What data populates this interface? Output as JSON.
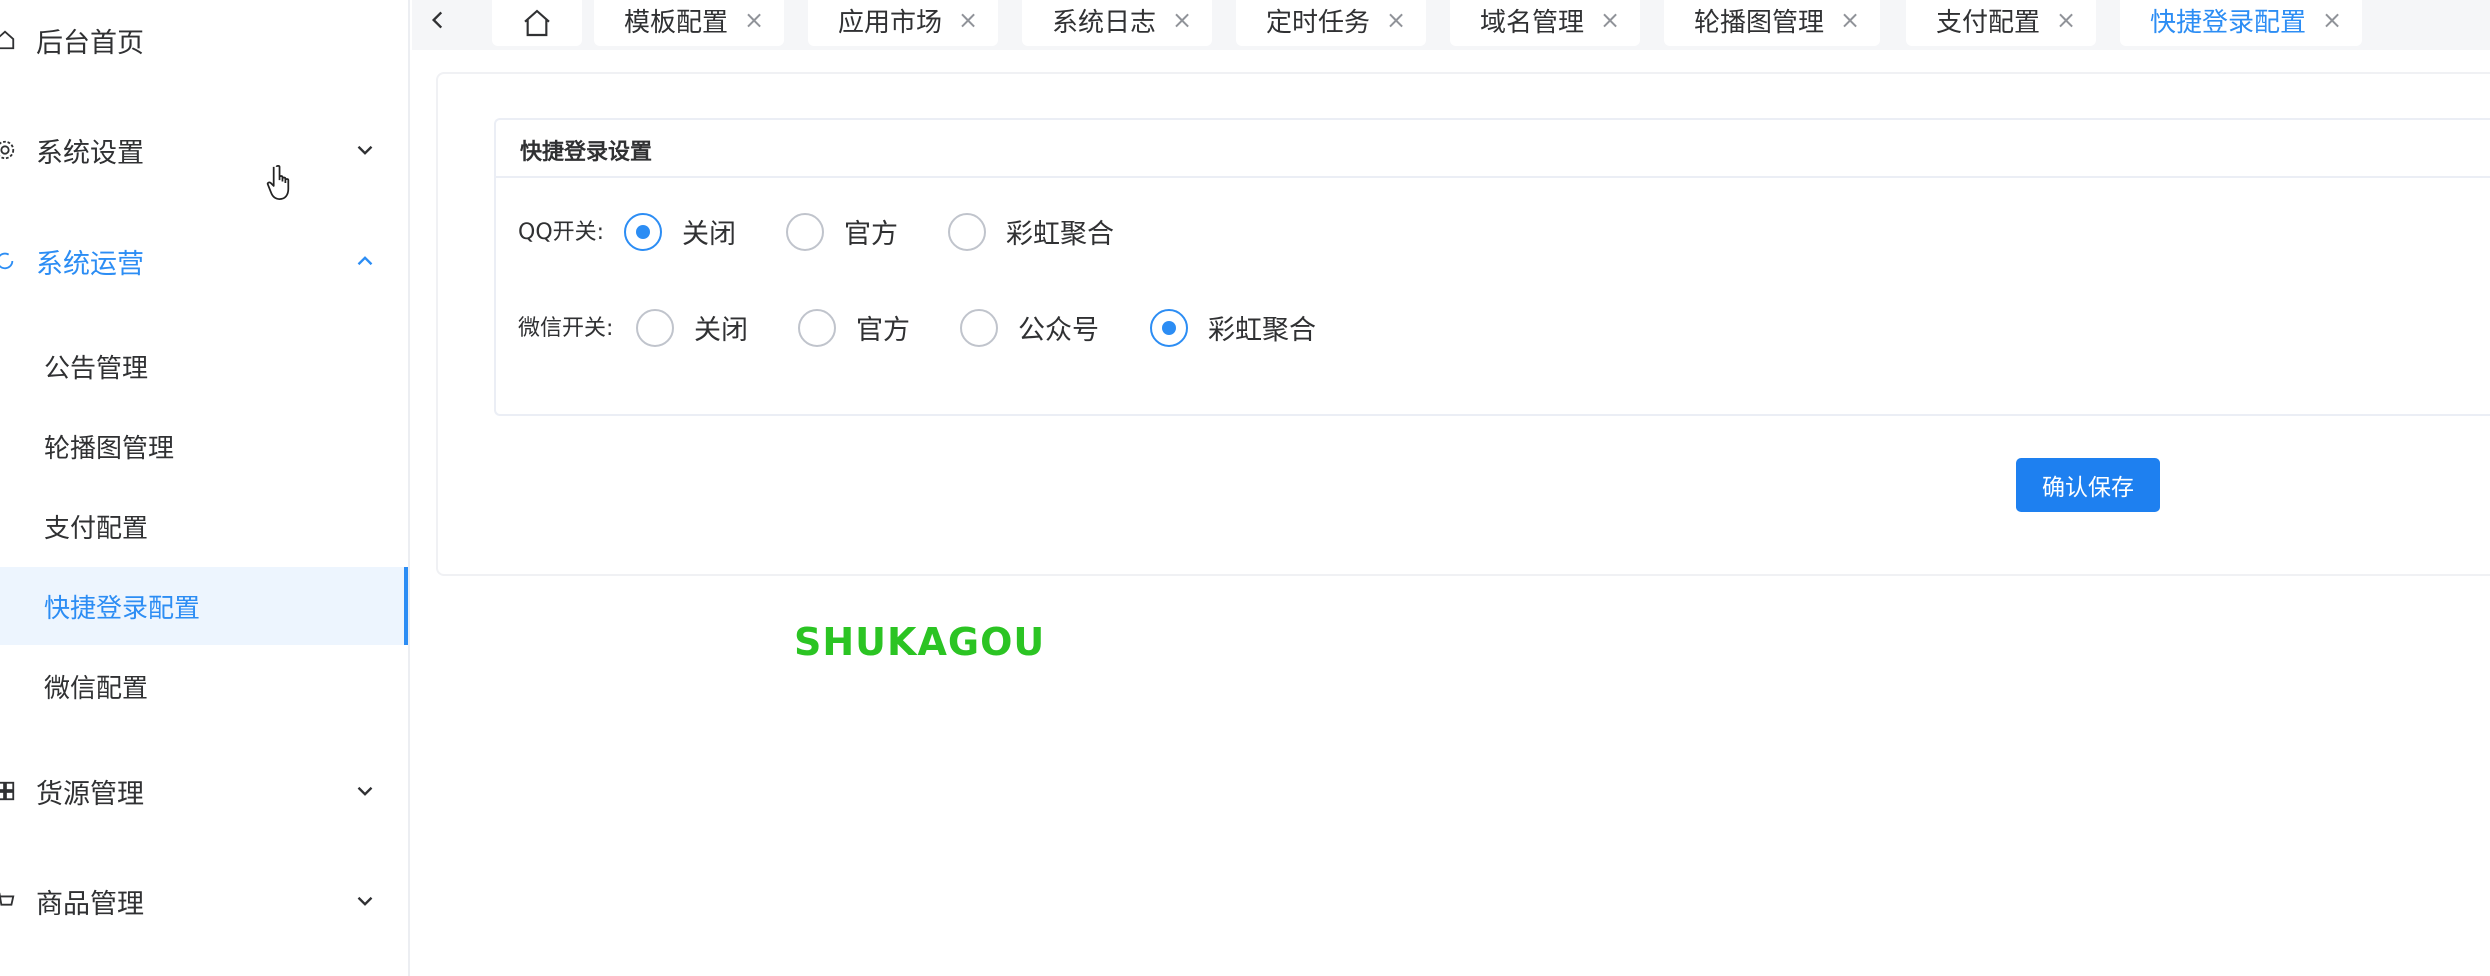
{
  "sidebar": {
    "items": [
      {
        "label": "后台首页",
        "icon": "home-icon"
      },
      {
        "label": "系统设置",
        "icon": "gear-icon",
        "expanded": false
      },
      {
        "label": "系统运营",
        "icon": "refresh-icon",
        "expanded": true
      },
      {
        "label": "货源管理",
        "icon": "grid-icon",
        "expanded": false
      },
      {
        "label": "商品管理",
        "icon": "cart-icon",
        "expanded": false
      }
    ],
    "sub_items": [
      {
        "label": "公告管理"
      },
      {
        "label": "轮播图管理"
      },
      {
        "label": "支付配置"
      },
      {
        "label": "快捷登录配置",
        "active": true
      },
      {
        "label": "微信配置"
      }
    ]
  },
  "tabs": [
    {
      "label": "模板配置"
    },
    {
      "label": "应用市场"
    },
    {
      "label": "系统日志"
    },
    {
      "label": "定时任务"
    },
    {
      "label": "域名管理"
    },
    {
      "label": "轮播图管理"
    },
    {
      "label": "支付配置"
    },
    {
      "label": "快捷登录配置",
      "active": true
    }
  ],
  "tab_close_glyph": "×",
  "settings": {
    "title": "快捷登录设置",
    "qq": {
      "label": "QQ开关:",
      "options": [
        "关闭",
        "官方",
        "彩虹聚合"
      ],
      "selected": "关闭"
    },
    "wechat": {
      "label": "微信开关:",
      "options": [
        "关闭",
        "官方",
        "公众号",
        "彩虹聚合"
      ],
      "selected": "彩虹聚合"
    }
  },
  "save_button": "确认保存",
  "watermark": "SHUKAGOU",
  "colors": {
    "accent": "#2c8df4",
    "button": "#1e80f0",
    "watermark": "#2bc423"
  }
}
